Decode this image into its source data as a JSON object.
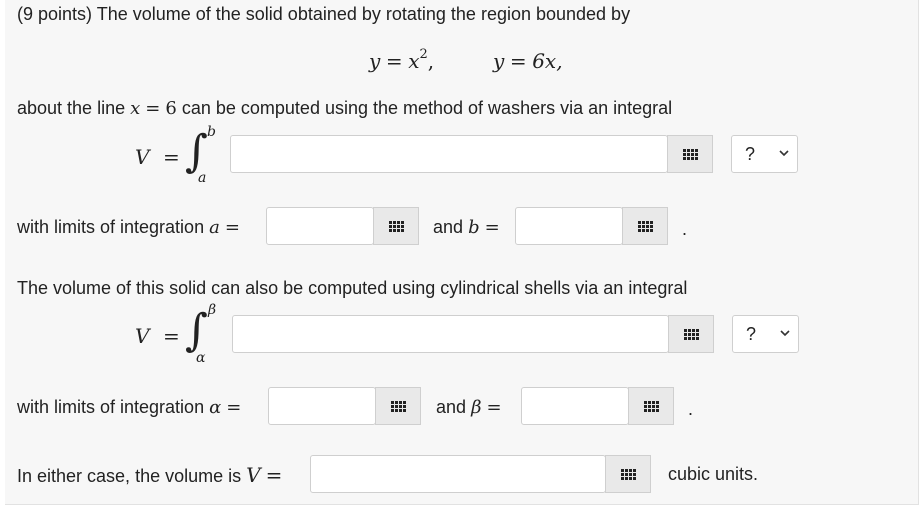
{
  "problem": {
    "intro": "(9 points) The volume of the solid obtained by rotating the region bounded by",
    "eq1_lhs": "y",
    "eq1_eq": "=",
    "eq1_rhs": "x",
    "eq1_exp": "2",
    "eq1_comma": ",",
    "eq2_lhs": "y",
    "eq2_eq": "=",
    "eq2_rhs": "6x,",
    "about_line_pre": "about the line",
    "about_x": "x",
    "about_eq": "=",
    "about_val": "6",
    "about_line_post": "can be computed using the method of washers via an integral"
  },
  "washers": {
    "V_label": "V",
    "eq": "=",
    "upper_limit": "b",
    "lower_limit": "a",
    "integrand_value": "",
    "differential_select": "?",
    "limits_text": "with limits of integration",
    "a_label": "a",
    "a_eq": "=",
    "a_value": "",
    "and_text": "and",
    "b_label": "b",
    "b_eq": "=",
    "b_value": "",
    "period": "."
  },
  "shells": {
    "intro": "The volume of this solid can also be computed using cylindrical shells via an integral",
    "V_label": "V",
    "eq": "=",
    "upper_limit": "β",
    "lower_limit": "α",
    "integrand_value": "",
    "differential_select": "?",
    "limits_text": "with limits of integration",
    "alpha_label": "α",
    "alpha_eq": "=",
    "alpha_value": "",
    "and_text": "and",
    "beta_label": "β",
    "beta_eq": "=",
    "beta_value": "",
    "period": "."
  },
  "result": {
    "text": "In either case, the volume is",
    "V_label": "V",
    "eq": "=",
    "value": "",
    "units": "cubic units."
  },
  "icons": {
    "palette": "grid-palette-icon",
    "chevron": "chevron-down-icon",
    "integral": "integral-sign"
  }
}
